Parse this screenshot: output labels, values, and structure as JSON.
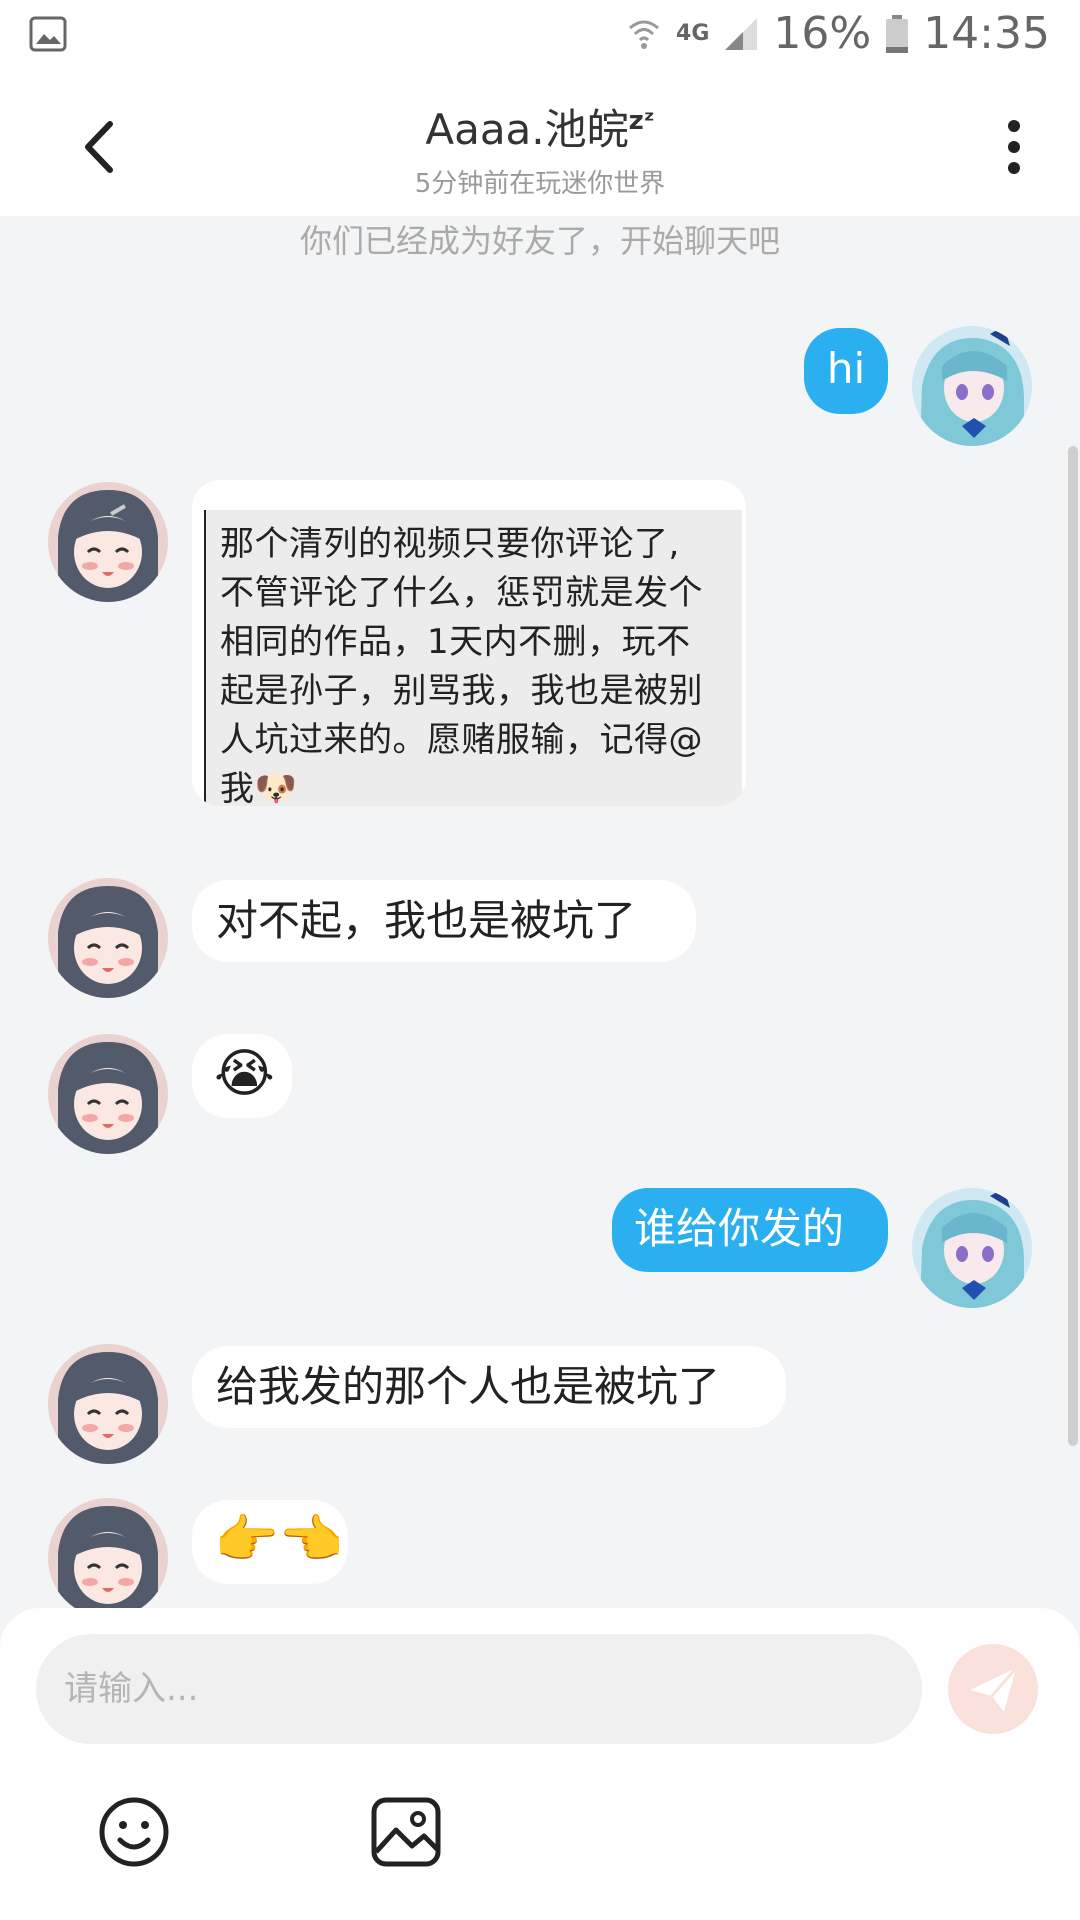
{
  "status_bar": {
    "battery": "16%",
    "time": "14:35",
    "network": "4G"
  },
  "header": {
    "title": "Aaaa.池皖",
    "title_suffix": "zᶻ",
    "subtitle": "5分钟前在玩迷你世界"
  },
  "chat": {
    "system_note": "你们已经成为好友了，开始聊天吧",
    "messages": [
      {
        "side": "out",
        "type": "text",
        "text": "hi"
      },
      {
        "side": "in",
        "type": "image",
        "image_lines": [
          "那个清列的视频只要你评论了,",
          "不管评论了什么，惩罚就是发个",
          "相同的作品，1天内不删，玩不",
          "起是孙子，别骂我，我也是被别",
          "人坑过来的。愿赌服输，记得@",
          "我🐶"
        ]
      },
      {
        "side": "in",
        "type": "text",
        "text": "对不起，我也是被坑了"
      },
      {
        "side": "in",
        "type": "emoji",
        "text": "😭"
      },
      {
        "side": "out",
        "type": "text",
        "text": "谁给你发的"
      },
      {
        "side": "in",
        "type": "text",
        "text": "给我发的那个人也是被坑了"
      },
      {
        "side": "in",
        "type": "emoji",
        "text": "👉👈"
      }
    ]
  },
  "composer": {
    "placeholder": "请输入..."
  },
  "colors": {
    "outgoing_bubble": "#2ab0f0",
    "incoming_bubble": "#ffffff",
    "background": "#f3f4f6",
    "send_button": "#fbe1dc"
  },
  "icons": [
    "gallery-icon",
    "wifi-icon",
    "signal-icon",
    "battery-icon",
    "back-arrow-icon",
    "more-vert-icon",
    "send-icon",
    "emoji-icon",
    "image-icon"
  ]
}
